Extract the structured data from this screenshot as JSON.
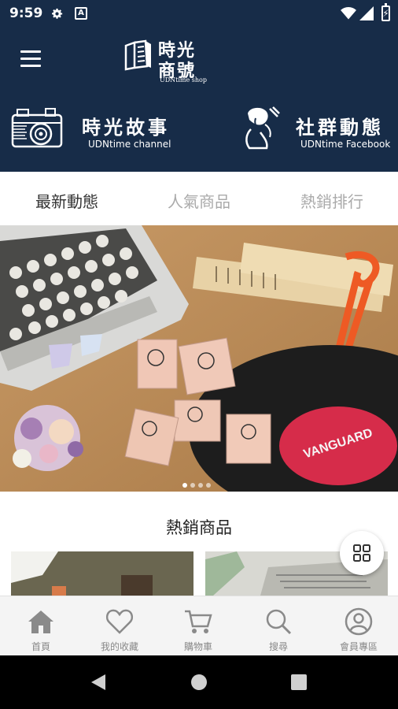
{
  "status_bar": {
    "time": "9:59",
    "icons": [
      "gear-icon",
      "a-notification-icon",
      "wifi-icon",
      "signal-icon",
      "battery-icon"
    ],
    "battery_glyph": "⚡"
  },
  "header": {
    "logo": {
      "line1": "時光",
      "line2": "商號",
      "sub": "UDNtime shop"
    },
    "channels": [
      {
        "title": "時光故事",
        "subtitle": "UDNtime channel",
        "icon": "camera-icon"
      },
      {
        "title": "社群動態",
        "subtitle": "UDNtime Facebook",
        "icon": "illustration-woman-icon"
      }
    ]
  },
  "tabs": [
    {
      "label": "最新動態",
      "active": true
    },
    {
      "label": "人氣商品",
      "active": false
    },
    {
      "label": "熱銷排行",
      "active": false
    }
  ],
  "banner": {
    "slide_count": 4,
    "active_index": 0
  },
  "hot_products": {
    "title": "熱銷商品"
  },
  "bottom_nav": [
    {
      "label": "首頁",
      "icon": "home-icon"
    },
    {
      "label": "我的收藏",
      "icon": "heart-icon"
    },
    {
      "label": "購物車",
      "icon": "cart-icon"
    },
    {
      "label": "搜尋",
      "icon": "search-icon"
    },
    {
      "label": "會員專區",
      "icon": "user-icon"
    }
  ],
  "colors": {
    "header_bg": "#172c48",
    "tab_active": "#333333",
    "tab_inactive": "#aaaaaa",
    "nav_bg": "#f4f4f4",
    "nav_icon": "#8a8a8a"
  }
}
